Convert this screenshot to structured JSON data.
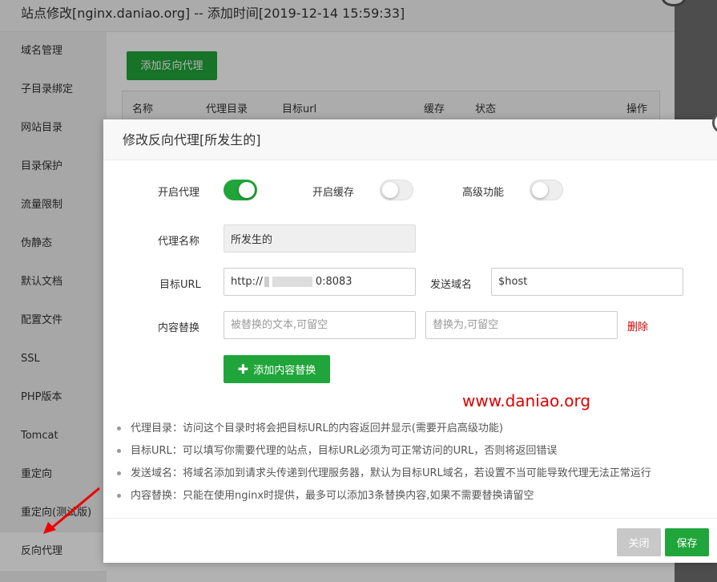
{
  "window": {
    "title": "站点修改[nginx.daniao.org] -- 添加时间[2019-12-14 15:59:33]"
  },
  "sidebar": {
    "items": [
      {
        "label": "域名管理"
      },
      {
        "label": "子目录绑定"
      },
      {
        "label": "网站目录"
      },
      {
        "label": "目录保护"
      },
      {
        "label": "流量限制"
      },
      {
        "label": "伪静态"
      },
      {
        "label": "默认文档"
      },
      {
        "label": "配置文件"
      },
      {
        "label": "SSL"
      },
      {
        "label": "PHP版本"
      },
      {
        "label": "Tomcat"
      },
      {
        "label": "重定向"
      },
      {
        "label": "重定向(测试版)"
      },
      {
        "label": "反向代理"
      }
    ],
    "active_index": 13
  },
  "main": {
    "add_button": "添加反向代理",
    "table_headers": [
      "名称",
      "代理目录",
      "目标url",
      "缓存",
      "状态",
      "操作"
    ]
  },
  "modal": {
    "title": "修改反向代理[所发生的]",
    "toggles": {
      "enable_proxy": {
        "label": "开启代理",
        "on": true
      },
      "enable_cache": {
        "label": "开启缓存",
        "on": false
      },
      "advanced": {
        "label": "高级功能",
        "on": false
      }
    },
    "proxy_name": {
      "label": "代理名称",
      "value": "所发生的"
    },
    "target_url": {
      "label": "目标URL",
      "value_prefix": "http://",
      "value_suffix": "0:8083"
    },
    "send_domain": {
      "label": "发送域名",
      "value": "$host"
    },
    "content_replace": {
      "label": "内容替换",
      "from_placeholder": "被替换的文本,可留空",
      "to_placeholder": "替换为,可留空",
      "delete_label": "删除"
    },
    "add_replace_button": "添加内容替换",
    "watermark": "www.daniao.org",
    "notes": [
      "代理目录：访问这个目录时将会把目标URL的内容返回并显示(需要开启高级功能)",
      "目标URL：可以填写你需要代理的站点，目标URL必须为可正常访问的URL，否则将返回错误",
      "发送域名：将域名添加到请求头传递到代理服务器，默认为目标URL域名，若设置不当可能导致代理无法正常运行",
      "内容替换：只能在使用nginx时提供，最多可以添加3条替换内容,如果不需要替换请留空"
    ],
    "close_button": "关闭",
    "save_button": "保存"
  },
  "colors": {
    "primary_green": "#20a53a",
    "danger_red": "#cc0000",
    "disabled_gray": "#c8c8c8"
  }
}
